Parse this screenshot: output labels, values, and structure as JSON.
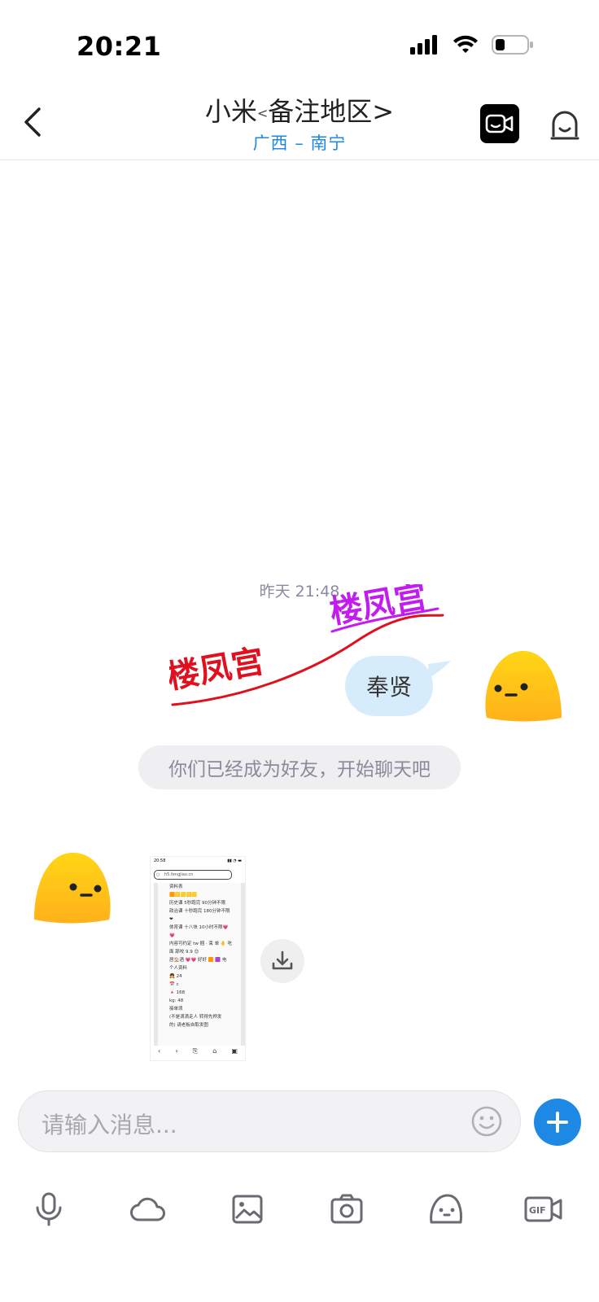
{
  "status_bar": {
    "time": "20:21"
  },
  "header": {
    "title_name": "小米",
    "title_lt": "<",
    "title_remark": "备注地区>",
    "subtitle": "广西 – 南宁"
  },
  "chat": {
    "timestamp": "昨天 21:48",
    "sticker": {
      "text_top": "楼凤宫",
      "text_bottom": "楼凤宫"
    },
    "sent_message": "奉贤",
    "system_notice": "你们已经成为好友，开始聊天吧",
    "image_message": {
      "mini_time": "20:58",
      "mini_url": "h5.fengjiao.cn",
      "mini_lines": [
        "资料表",
        "🟧🟨🟨🟨🟨",
        "历史课 5秒跑完 90分钟不限",
        "政治课 十秒跑完 180分钟不限",
        "❤",
        "体育课 十八块 10小时不限💗",
        "💗",
        "内容可约定 tw 捆 · 束 单 🤚 吃",
        "面 舔咬 9.9 😊",
        "居🏠酒 💗💗 好好 🟧 🟪 电",
        "个人资料",
        "👧 24",
        "📅 c",
        "🔺 168",
        "kg: 48",
        "接单须",
        "(不是滴滴走人 转得先押发",
        "的) 请老板自取发图"
      ]
    }
  },
  "input": {
    "placeholder": "请输入消息..."
  },
  "toolbar": {
    "items": [
      "microphone-icon",
      "cloud-icon",
      "image-icon",
      "camera-icon",
      "sticker-icon",
      "gif-icon"
    ]
  },
  "colors": {
    "accent": "#1e88e5",
    "bubble_sent": "#d7ecfb",
    "system_pill": "#efeff2",
    "avatar_yellow": "#ffd21a",
    "sticker_red": "#e0101e",
    "sticker_magenta": "#c21cf0"
  }
}
